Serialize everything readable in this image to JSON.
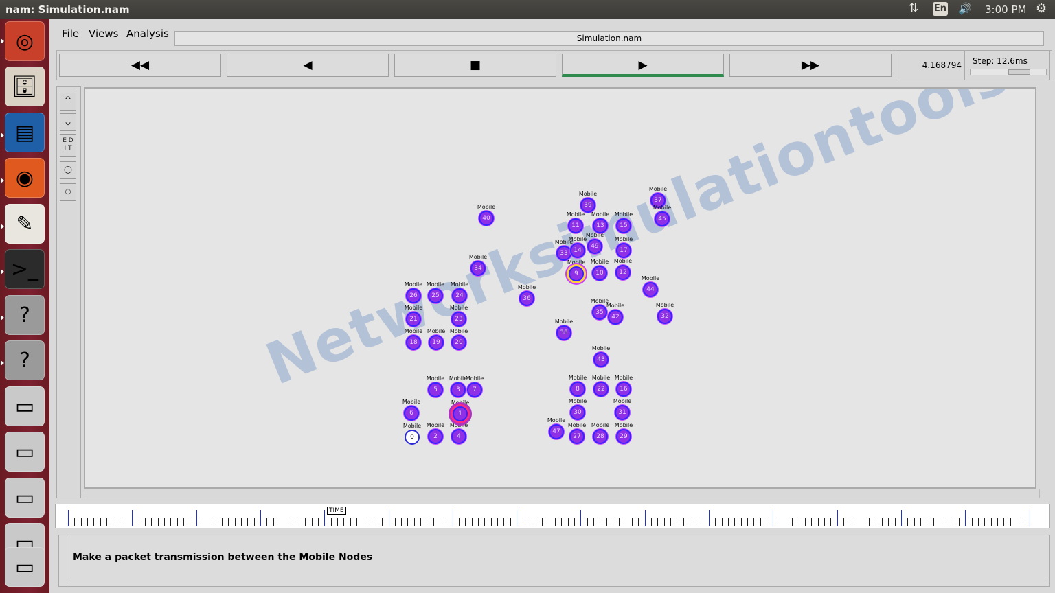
{
  "topbar": {
    "window_title": "nam: Simulation.nam",
    "lang": "En",
    "clock": "3:00 PM",
    "net_icon": "⇅",
    "vol_icon": "🔊",
    "gear_icon": "⚙"
  },
  "launcher": {
    "items": [
      {
        "name": "ubuntu-dash-icon",
        "glyph": "◎",
        "bg": "#c8402a"
      },
      {
        "name": "files-icon",
        "glyph": "🗄",
        "bg": "#d9d2c5"
      },
      {
        "name": "writer-icon",
        "glyph": "▤",
        "bg": "#1f5fa8"
      },
      {
        "name": "firefox-icon",
        "glyph": "◉",
        "bg": "#e05a20"
      },
      {
        "name": "text-editor-icon",
        "glyph": "✎",
        "bg": "#e9e6df"
      },
      {
        "name": "terminal-icon",
        "glyph": ">_",
        "bg": "#2b2b2b"
      },
      {
        "name": "unknown-app-icon",
        "glyph": "?",
        "bg": "#9a9a9a"
      },
      {
        "name": "unknown-app-icon",
        "glyph": "?",
        "bg": "#9a9a9a"
      },
      {
        "name": "drive-icon",
        "glyph": "▭",
        "bg": "#c9c9c9"
      },
      {
        "name": "drive-icon",
        "glyph": "▭",
        "bg": "#c9c9c9"
      },
      {
        "name": "drive-icon",
        "glyph": "▭",
        "bg": "#c9c9c9"
      },
      {
        "name": "drive-icon",
        "glyph": "▭",
        "bg": "#c9c9c9"
      },
      {
        "name": "drive-icon",
        "glyph": "▭",
        "bg": "#c9c9c9"
      }
    ]
  },
  "menubar": {
    "file": "File",
    "views": "Views",
    "analysis": "Analysis",
    "file_title": "Simulation.nam"
  },
  "controls": {
    "rewind": "◀◀",
    "back": "◀",
    "stop": "■",
    "play": "▶",
    "fast_forward": "▶▶",
    "time": "4.168794",
    "step": "Step: 12.6ms",
    "step_fraction": 0.7
  },
  "tools": {
    "zoom_in": "⇧",
    "zoom_out": "⇩",
    "edit": "E D\nI T",
    "circle1": "○",
    "circle2": "○"
  },
  "node_label": "Mobile",
  "nodes": [
    {
      "id": "0",
      "style": "plain"
    },
    {
      "id": "2"
    },
    {
      "id": "4"
    },
    {
      "id": "6"
    },
    {
      "id": "1",
      "style": "hl"
    },
    {
      "id": "5"
    },
    {
      "id": "3"
    },
    {
      "id": "7"
    },
    {
      "id": "18"
    },
    {
      "id": "19"
    },
    {
      "id": "20"
    },
    {
      "id": "21"
    },
    {
      "id": "23"
    },
    {
      "id": "26"
    },
    {
      "id": "25"
    },
    {
      "id": "24"
    },
    {
      "id": "34"
    },
    {
      "id": "40"
    },
    {
      "id": "36"
    },
    {
      "id": "39"
    },
    {
      "id": "11"
    },
    {
      "id": "13"
    },
    {
      "id": "15"
    },
    {
      "id": "37"
    },
    {
      "id": "45"
    },
    {
      "id": "33"
    },
    {
      "id": "14"
    },
    {
      "id": "49"
    },
    {
      "id": "17"
    },
    {
      "id": "9",
      "style": "hl2"
    },
    {
      "id": "10"
    },
    {
      "id": "12"
    },
    {
      "id": "44"
    },
    {
      "id": "35"
    },
    {
      "id": "42"
    },
    {
      "id": "32"
    },
    {
      "id": "38"
    },
    {
      "id": "43"
    },
    {
      "id": "8"
    },
    {
      "id": "22"
    },
    {
      "id": "16"
    },
    {
      "id": "30"
    },
    {
      "id": "31"
    },
    {
      "id": "47"
    },
    {
      "id": "27"
    },
    {
      "id": "28"
    },
    {
      "id": "29"
    }
  ],
  "watermark": "Networksimulationtools.com",
  "timeline": {
    "marker": "TIME"
  },
  "annotation": {
    "text": "Make a packet transmission between the Mobile Nodes"
  },
  "colors": {
    "accent_play": "#2f8a4e",
    "node_fill": "#8f2fe6",
    "node_border": "#3524ff"
  }
}
